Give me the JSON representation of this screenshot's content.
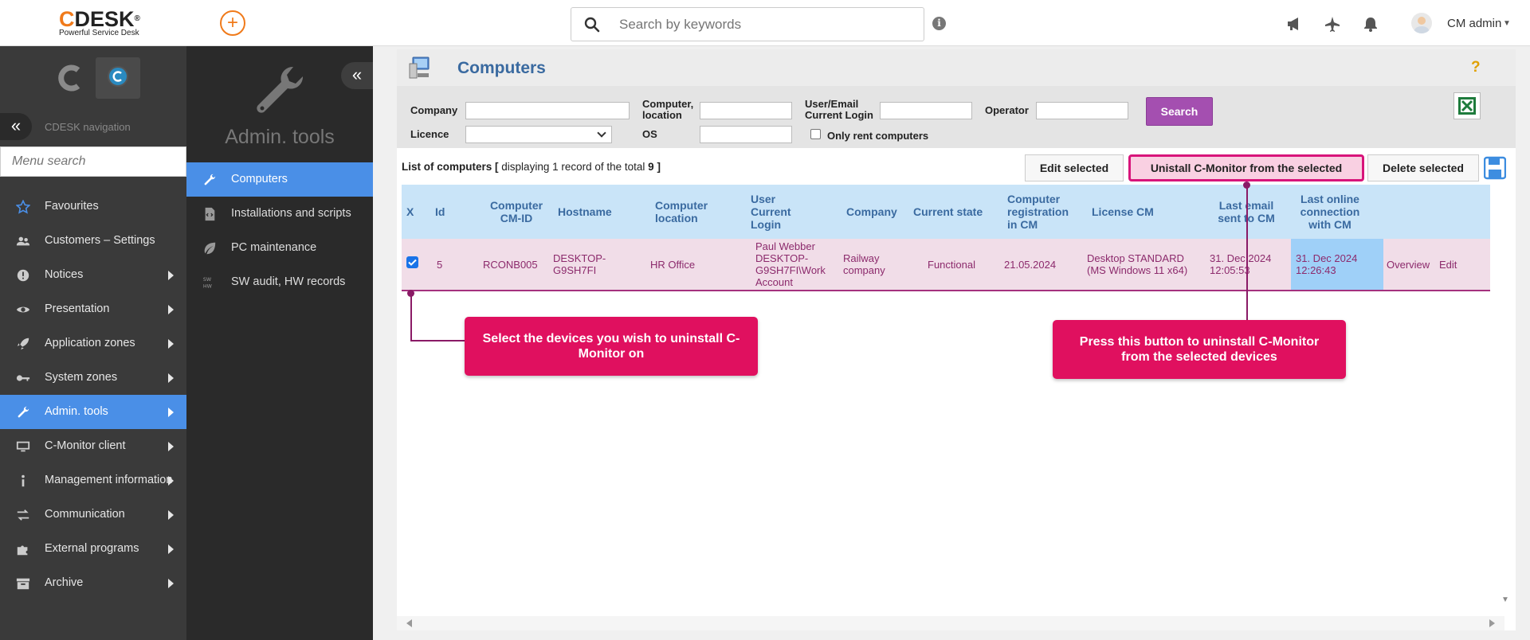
{
  "header": {
    "logo_brand": "CDESK",
    "logo_tagline": "Powerful Service Desk",
    "search_placeholder": "Search by keywords",
    "user_name": "CM admin"
  },
  "leftnav": {
    "caption": "CDESK navigation",
    "menu_search_placeholder": "Menu search",
    "items": [
      {
        "label": "Favourites",
        "icon": "star-icon"
      },
      {
        "label": "Customers – Settings",
        "icon": "users-icon"
      },
      {
        "label": "Notices",
        "icon": "exclamation-icon"
      },
      {
        "label": "Presentation",
        "icon": "eye-icon"
      },
      {
        "label": "Application zones",
        "icon": "rocket-icon"
      },
      {
        "label": "System zones",
        "icon": "key-icon"
      },
      {
        "label": "Admin. tools",
        "icon": "wrench-icon"
      },
      {
        "label": "C-Monitor client",
        "icon": "monitor-icon"
      },
      {
        "label": "Management information",
        "icon": "info-icon"
      },
      {
        "label": "Communication",
        "icon": "exchange-icon"
      },
      {
        "label": "External programs",
        "icon": "puzzle-icon"
      },
      {
        "label": "Archive",
        "icon": "archive-icon"
      }
    ]
  },
  "subnav": {
    "title": "Admin. tools",
    "items": [
      {
        "label": "Computers",
        "icon": "wrench-icon"
      },
      {
        "label": "Installations and scripts",
        "icon": "script-icon"
      },
      {
        "label": "PC maintenance",
        "icon": "leaf-icon"
      },
      {
        "label": "SW audit, HW records",
        "icon": "sw-hw-icon"
      }
    ]
  },
  "page": {
    "title": "Computers",
    "help": "?"
  },
  "filters": {
    "company_label": "Company",
    "computer_location_label": "Computer, location",
    "user_login_label": "User/Email Current Login",
    "operator_label": "Operator",
    "licence_label": "Licence",
    "os_label": "OS",
    "only_rent_label": "Only rent computers",
    "search_button": "Search"
  },
  "list": {
    "title": "List of computers",
    "info_prefix": "[",
    "info_text": "displaying 1 record of the total",
    "info_total": "9",
    "info_suffix": "]",
    "edit_selected": "Edit selected",
    "uninstall_selected": "Unistall C-Monitor from the selected",
    "delete_selected": "Delete selected"
  },
  "table": {
    "columns": [
      "X",
      "Id",
      "Computer CM-ID",
      "Hostname",
      "Computer location",
      "User Current Login",
      "Company",
      "Current state",
      "Computer registration in CM",
      "License CM",
      "Last email sent to CM",
      "Last online connection with CM"
    ],
    "rows": [
      {
        "selected": true,
        "id": "5",
        "cm_id": "RCONB005",
        "hostname": "DESKTOP-G9SH7FI",
        "location": "HR Office",
        "user_login": "Paul Webber DESKTOP-G9SH7FI\\Work Account",
        "company": "Railway company",
        "state": "Functional",
        "registration": "21.05.2024",
        "license": "Desktop STANDARD (MS Windows 11 x64)",
        "last_email": "31. Dec 2024 12:05:53",
        "last_online": "31. Dec 2024 12:26:43",
        "action_overview": "Overview",
        "action_edit": "Edit"
      }
    ]
  },
  "callouts": {
    "select_devices": "Select the devices you wish to uninstall C-Monitor on",
    "press_button": "Press this button to uninstall C-Monitor from the selected devices"
  },
  "colors": {
    "accent_blue": "#4a8fe7",
    "callout_pink": "#e0105f",
    "search_purple": "#a44fb0",
    "brand_orange": "#f07a1a"
  }
}
